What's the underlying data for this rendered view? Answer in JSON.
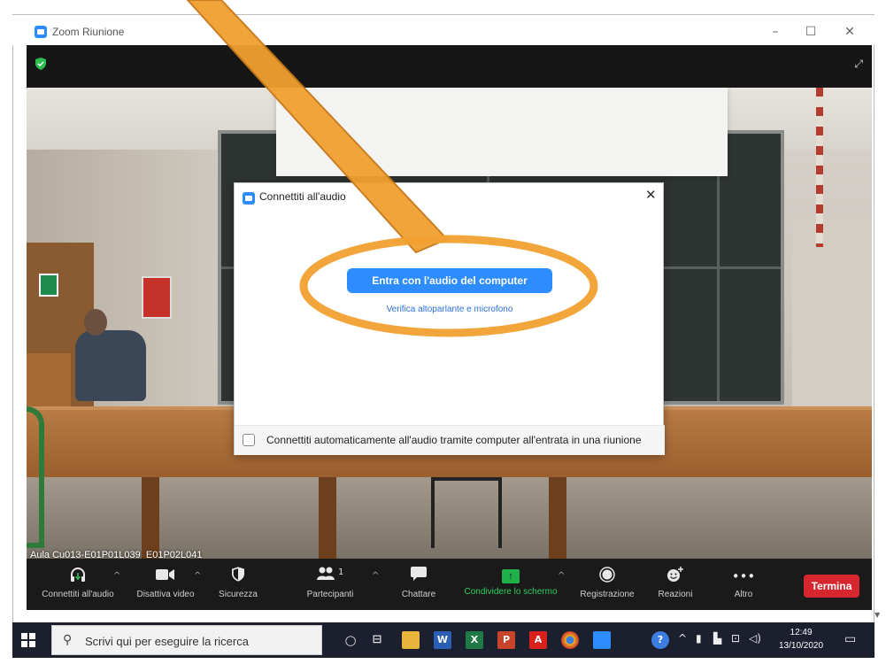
{
  "window": {
    "title": "Zoom Riunione"
  },
  "meeting": {
    "room_label": "Aula Cu013-E01P01L039_E01P02L041"
  },
  "dialog": {
    "title": "Connettiti all'audio",
    "join_button": "Entra con l'audio del computer",
    "verify_link": "Verifica altoparlante e microfono",
    "auto_join_label": "Connettiti automaticamente all'audio tramite computer all'entrata in una riunione",
    "auto_join_checked": false
  },
  "toolbar": {
    "audio": "Connettiti all'audio",
    "video": "Disattiva video",
    "security": "Sicurezza",
    "participants": "Partecipanti",
    "participants_count": "1",
    "chat": "Chattare",
    "share": "Condividere lo schermo",
    "record": "Registrazione",
    "reactions": "Reazioni",
    "more": "Altro",
    "end": "Termina"
  },
  "taskbar": {
    "search_placeholder": "Scrivi qui per eseguire la ricerca",
    "time": "12:49",
    "date": "13/10/2020"
  },
  "colors": {
    "accent": "#2d8cff",
    "highlight": "#f0a030",
    "end_button": "#d7262e",
    "share_green": "#1fb04a"
  }
}
